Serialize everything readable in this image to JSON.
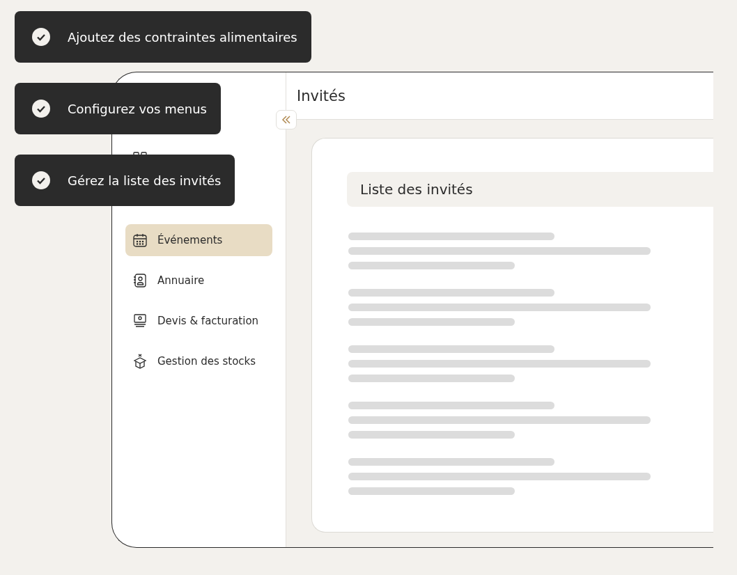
{
  "badges": [
    {
      "label": "Ajoutez des contraintes alimentaires"
    },
    {
      "label": "Configurez vos menus"
    },
    {
      "label": "Gérez la liste des invités"
    }
  ],
  "sidebar": {
    "items": [
      {
        "kind": "dashboard",
        "selected": false
      },
      {
        "kind": "calendar",
        "label": "Événements",
        "selected": true
      },
      {
        "kind": "contacts",
        "label": "Annuaire",
        "selected": false
      },
      {
        "kind": "invoice",
        "label": "Devis & facturation",
        "selected": false
      },
      {
        "kind": "stock",
        "label": "Gestion des stocks",
        "selected": false
      }
    ]
  },
  "header": {
    "title": "Invités"
  },
  "card": {
    "title": "Liste des invités"
  }
}
